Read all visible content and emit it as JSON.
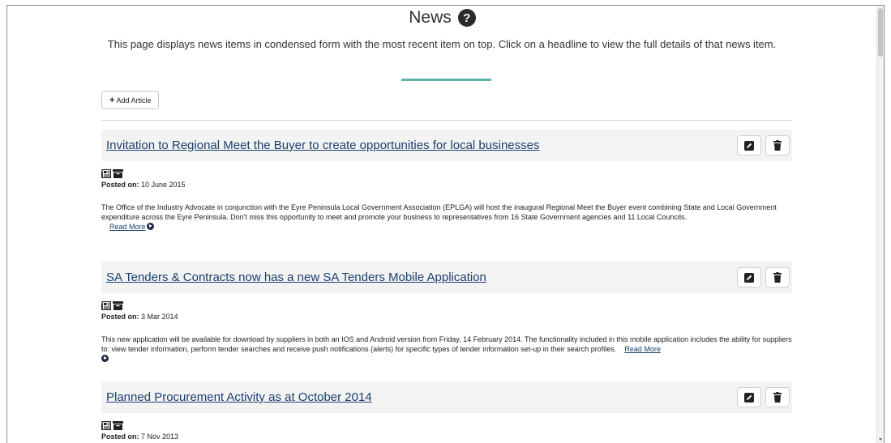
{
  "header": {
    "title": "News",
    "help_icon": "question-circle-icon",
    "intro": "This page displays news items in condensed form with the most recent item on top. Click on a headline to view the full details of that news item."
  },
  "toolbar": {
    "add_label": "Add Article"
  },
  "colors": {
    "accent": "#5fb3a9",
    "link": "#1c3f6e",
    "headline_bg": "#f3f3f3"
  },
  "posted_label": "Posted on:",
  "read_more_label": "Read More",
  "articles": [
    {
      "headline": "Invitation to Regional Meet the Buyer to create opportunities for local businesses",
      "date": "10 June 2015",
      "summary": "The Office of the Industry Advocate in conjunction with the Eyre Peninsula Local Government Association (EPLGA) will host the inaugural Regional Meet the Buyer event combining State and Local Government expenditure across the Eyre Peninsula. Don't miss this opportunity to meet and promote your business to representatives from 16 State Government agencies and 11 Local Councils."
    },
    {
      "headline": "SA Tenders & Contracts now has a new SA Tenders Mobile Application",
      "date": "3 Mar 2014",
      "summary": "This new application will be available for download by suppliers in both an IOS and Android version from Friday, 14 February 2014. The functionality included in this mobile application includes the ability for suppliers to: view tender information, perform tender searches and receive push notifications (alerts) for specific types of tender information set-up in their search profiles."
    },
    {
      "headline": "Planned Procurement Activity as at October 2014",
      "date": "7 Nov 2013",
      "summary": ""
    }
  ]
}
